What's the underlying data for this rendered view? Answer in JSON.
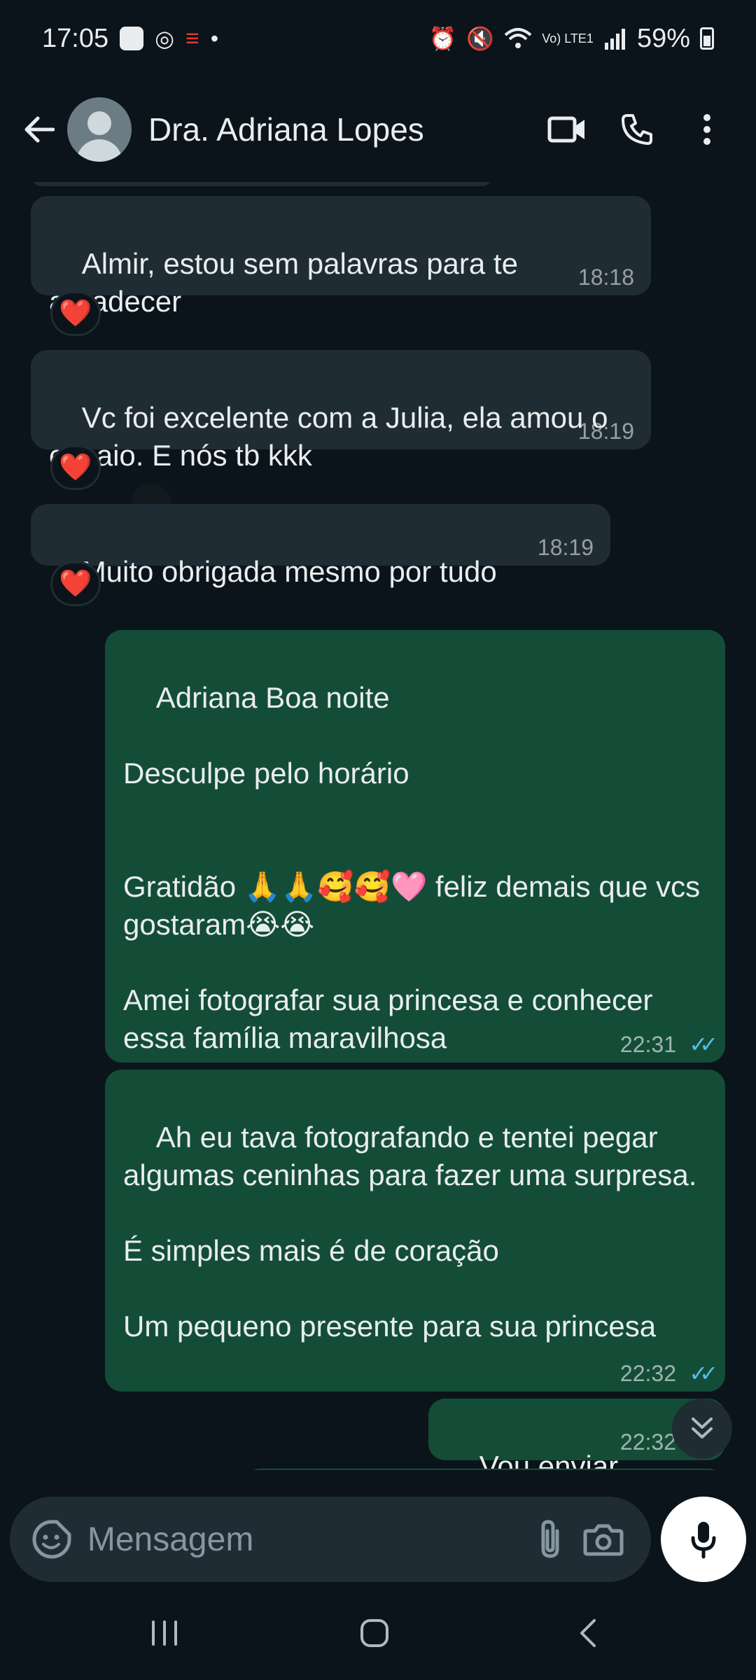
{
  "status_bar": {
    "time": "17:05",
    "battery": "59%",
    "network": "Vo) LTE1"
  },
  "header": {
    "contact_name": "Dra. Adriana Lopes",
    "icons": [
      "back-arrow-icon",
      "video-call-icon",
      "phone-icon",
      "more-vert-icon"
    ]
  },
  "messages": [
    {
      "direction": "in",
      "text": "Almir, estou sem palavras para te agradecer",
      "time": "18:18",
      "reaction": "❤️"
    },
    {
      "direction": "in",
      "text": "Vc foi excelente com a Julia, ela amou o ensaio. E nós tb kkk",
      "time": "18:19",
      "reaction": "❤️"
    },
    {
      "direction": "in",
      "text": "Muito obrigada mesmo por tudo",
      "time": "18:19",
      "reaction": "❤️"
    },
    {
      "direction": "out",
      "text": "Adriana Boa noite\n\nDesculpe pelo horário\n\n\nGratidão 🙏🙏🥰🥰🩷 feliz demais que vcs gostaram😭😭\n\nAmei fotografar sua princesa e conhecer essa família maravilhosa",
      "time": "22:31",
      "status": "read"
    },
    {
      "direction": "out",
      "text": "Ah eu tava fotografando e tentei pegar algumas ceninhas para fazer uma surpresa.\n\nÉ simples mais é de coração\n\nUm pequeno presente para sua princesa",
      "time": "22:32",
      "status": "read"
    },
    {
      "direction": "out",
      "text": "Vou enviar",
      "time": "22:32",
      "status": "read"
    }
  ],
  "composer": {
    "placeholder": "Mensagem"
  },
  "colors": {
    "background": "#0b141a",
    "incoming_bubble": "#202c33",
    "outgoing_bubble": "#144d37",
    "read_ticks": "#53bdeb"
  }
}
